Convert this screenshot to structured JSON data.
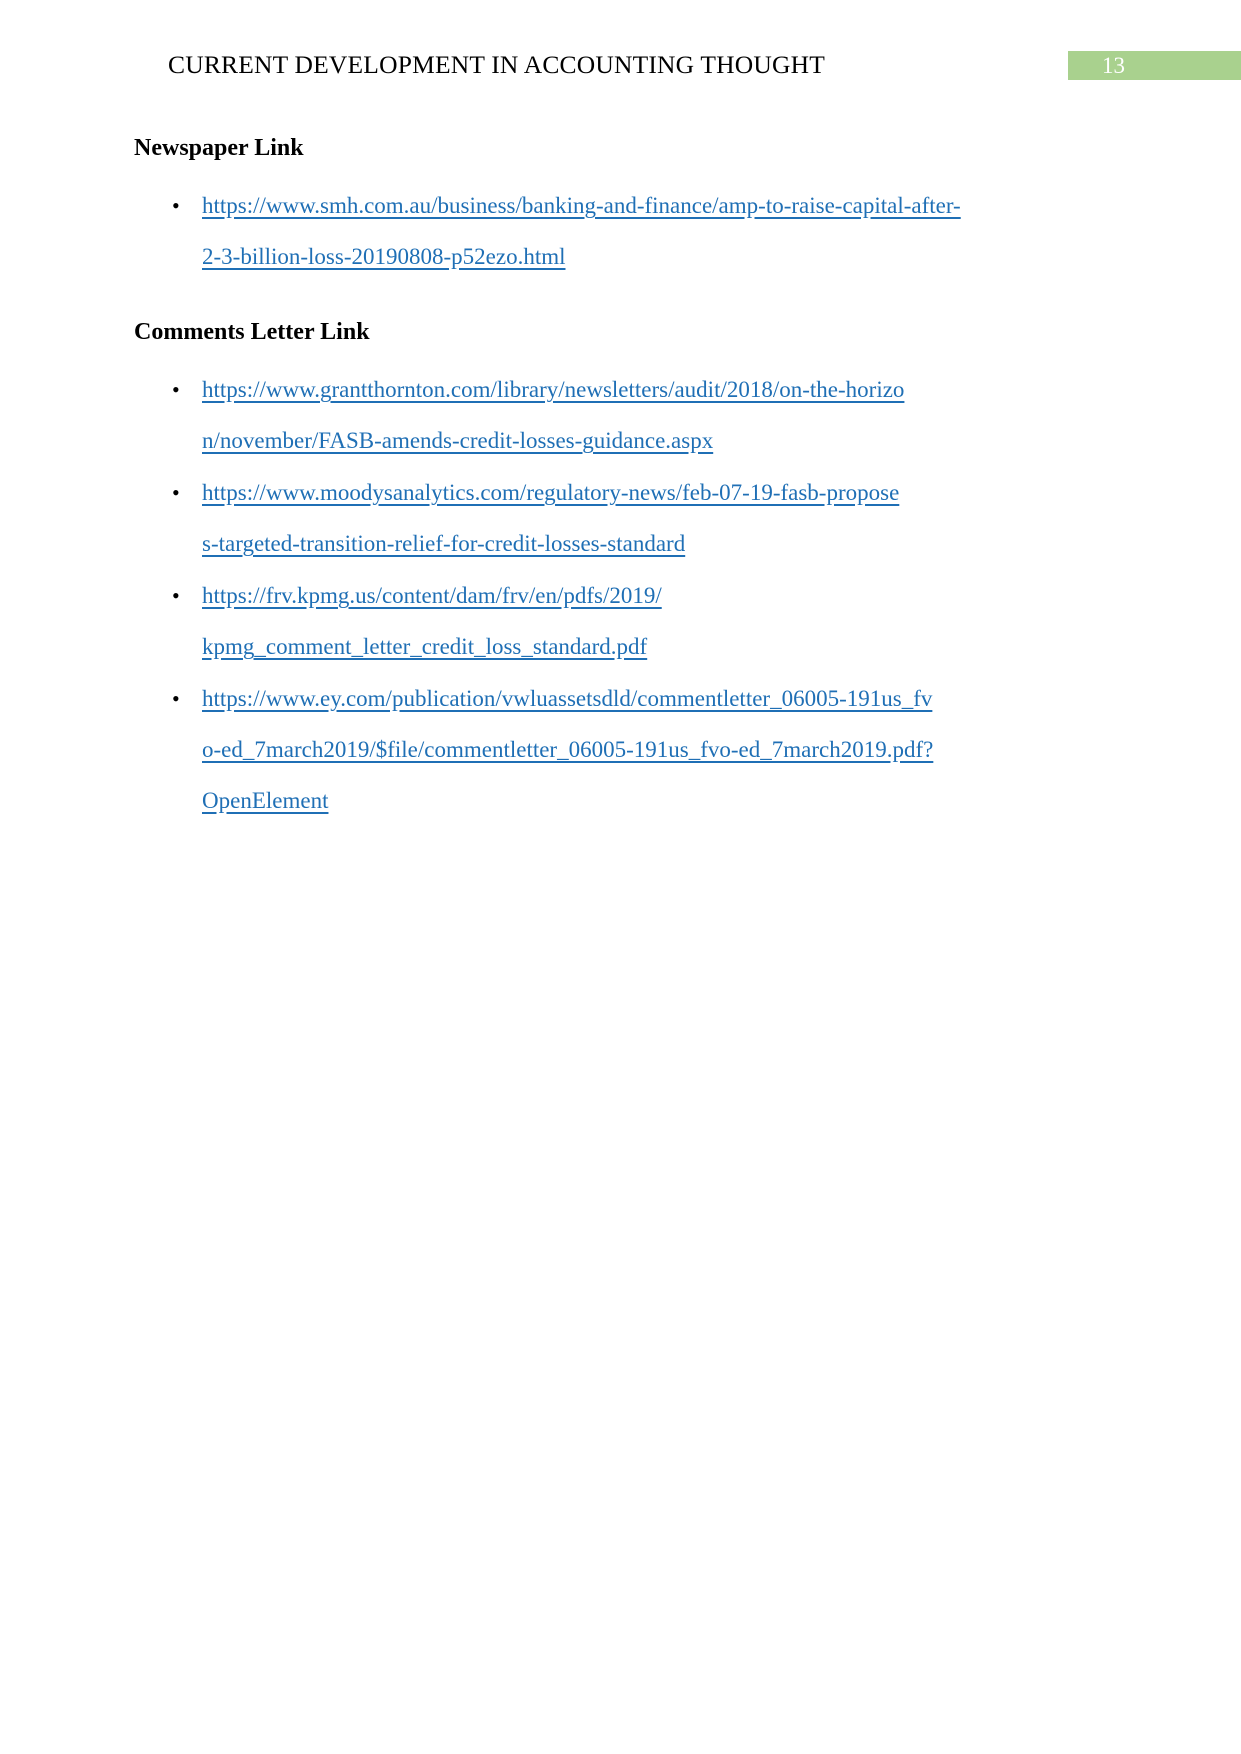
{
  "header": {
    "title": "CURRENT DEVELOPMENT IN ACCOUNTING THOUGHT",
    "page_number": "13",
    "badge_color": "#a9d18e",
    "badge_text_color": "#ffffff"
  },
  "colors": {
    "link": "#1f6fb5",
    "text": "#000000",
    "background": "#ffffff"
  },
  "bullet_glyph": "•",
  "sections": [
    {
      "heading": "Newspaper Link",
      "links": [
        "https://www.smh.com.au/business/banking-and-finance/amp-to-raise-capital-after-2-3-billion-loss-20190808-p52ezo.html"
      ]
    },
    {
      "heading": "Comments Letter Link",
      "links": [
        "https://www.grantthornton.com/library/newsletters/audit/2018/on-the-horizon/november/FASB-amends-credit-losses-guidance.aspx",
        "https://www.moodysanalytics.com/regulatory-news/feb-07-19-fasb-proposes-targeted-transition-relief-for-credit-losses-standard",
        "https://frv.kpmg.us/content/dam/frv/en/pdfs/2019/kpmg_comment_letter_credit_loss_standard.pdf",
        "https://www.ey.com/publication/vwluassetsdld/commentletter_06005-191us_fvo-ed_7march2019/$file/commentletter_06005-191us_fvo-ed_7march2019.pdf?OpenElement"
      ]
    }
  ]
}
